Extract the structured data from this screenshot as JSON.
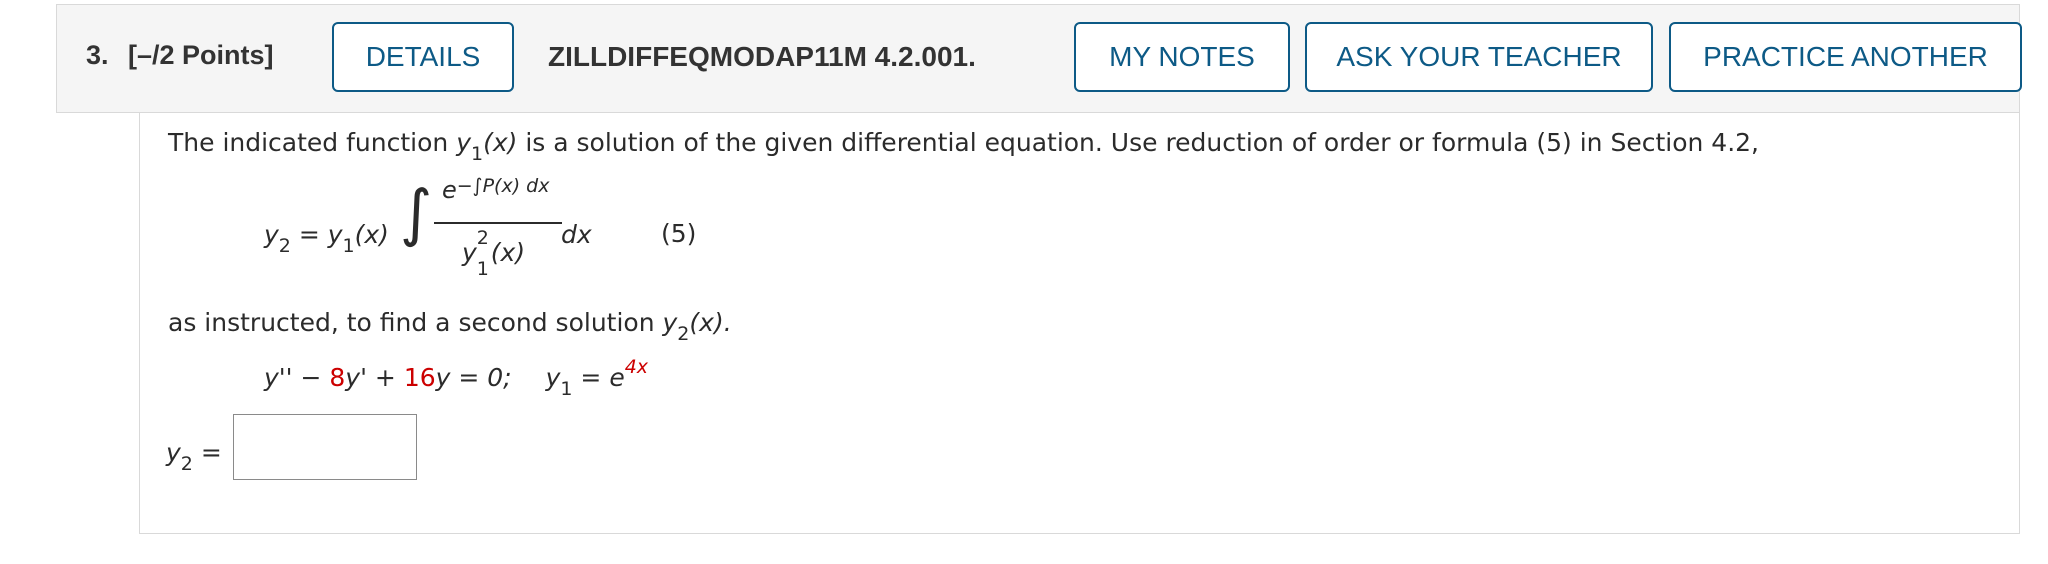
{
  "header": {
    "question_number": "3.",
    "points": "[–/2 Points]",
    "details_label": "DETAILS",
    "problem_code": "ZILLDIFFEQMODAP11M 4.2.001.",
    "my_notes_label": "MY NOTES",
    "ask_teacher_label": "ASK YOUR TEACHER",
    "practice_label": "PRACTICE ANOTHER"
  },
  "problem": {
    "intro_before": "The indicated function ",
    "intro_y": "y",
    "intro_sub": "1",
    "intro_arg": "(x)",
    "intro_after": " is a solution of the given differential equation. Use reduction of order or formula (5) in Section 4.2,",
    "formula": {
      "lhs_y": "y",
      "lhs_sub": "2",
      "equals": " = ",
      "y1": "y",
      "y1_sub": "1",
      "y1_arg": "(x)",
      "integral": "∫",
      "numerator_e": "e",
      "numerator_exp": "−∫P(x) dx",
      "denominator_y": "y",
      "denominator_sup": "2",
      "denominator_sub": "1",
      "denominator_arg": "(x)",
      "dx": "dx",
      "number": "(5)"
    },
    "instruction_before": "as instructed, to find a second solution ",
    "instruction_y": "y",
    "instruction_sub": "2",
    "instruction_arg": "(x).",
    "equation": {
      "part1": "y'' − ",
      "coef1": "8",
      "part2": "y' + ",
      "coef2": "16",
      "part3": "y = 0;",
      "y1": "y",
      "y1_sub": "1",
      "equals": " = e",
      "exp": "4x"
    },
    "answer_label_y": "y",
    "answer_label_sub": "2",
    "answer_label_eq": " =",
    "answer_value": ""
  },
  "colors": {
    "accent": "#0d5a86",
    "highlight": "#cc0000"
  }
}
